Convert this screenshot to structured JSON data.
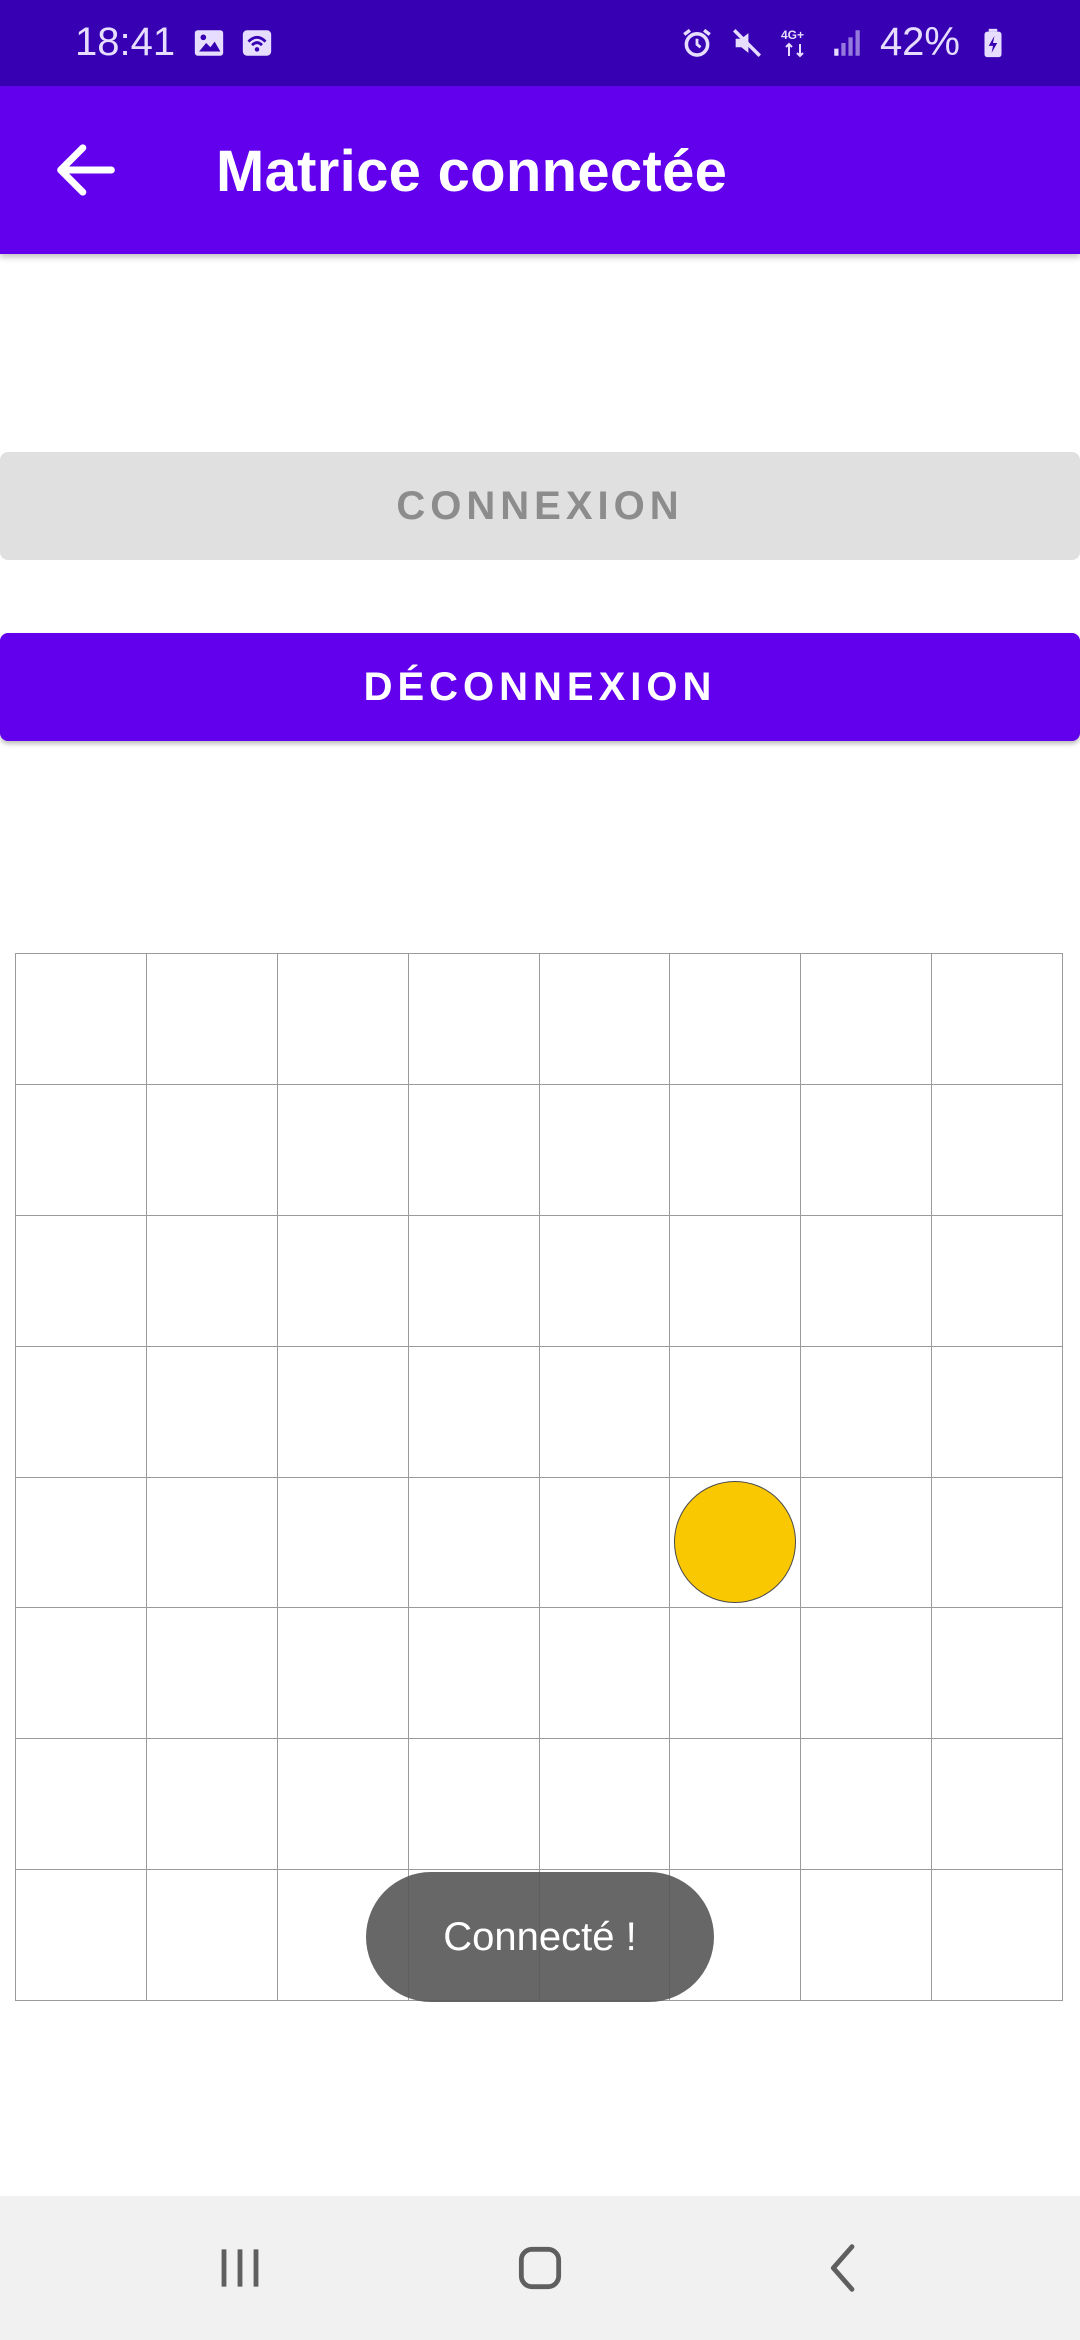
{
  "status_bar": {
    "time": "18:41",
    "network": "4G+",
    "battery": "42%",
    "icons": [
      "image-icon",
      "wifi-calling-icon",
      "alarm-icon",
      "mute-icon",
      "signal-icon",
      "battery-charging-icon"
    ]
  },
  "app_bar": {
    "title": "Matrice connectée",
    "back_icon": "arrow-left-icon"
  },
  "buttons": {
    "connect_label": "CONNEXION",
    "disconnect_label": "DÉCONNEXION"
  },
  "matrix": {
    "rows": 8,
    "cols": 8,
    "active_cell": {
      "row": 4,
      "col": 5
    },
    "dot_color": "#fac800"
  },
  "toast": {
    "message": "Connecté !"
  },
  "colors": {
    "primary": "#6200ee",
    "primary_dark": "#3700b3",
    "disabled_bg": "#e0e0e0"
  },
  "nav_bar": {
    "icons": [
      "recent-apps-icon",
      "home-icon",
      "back-icon"
    ]
  }
}
